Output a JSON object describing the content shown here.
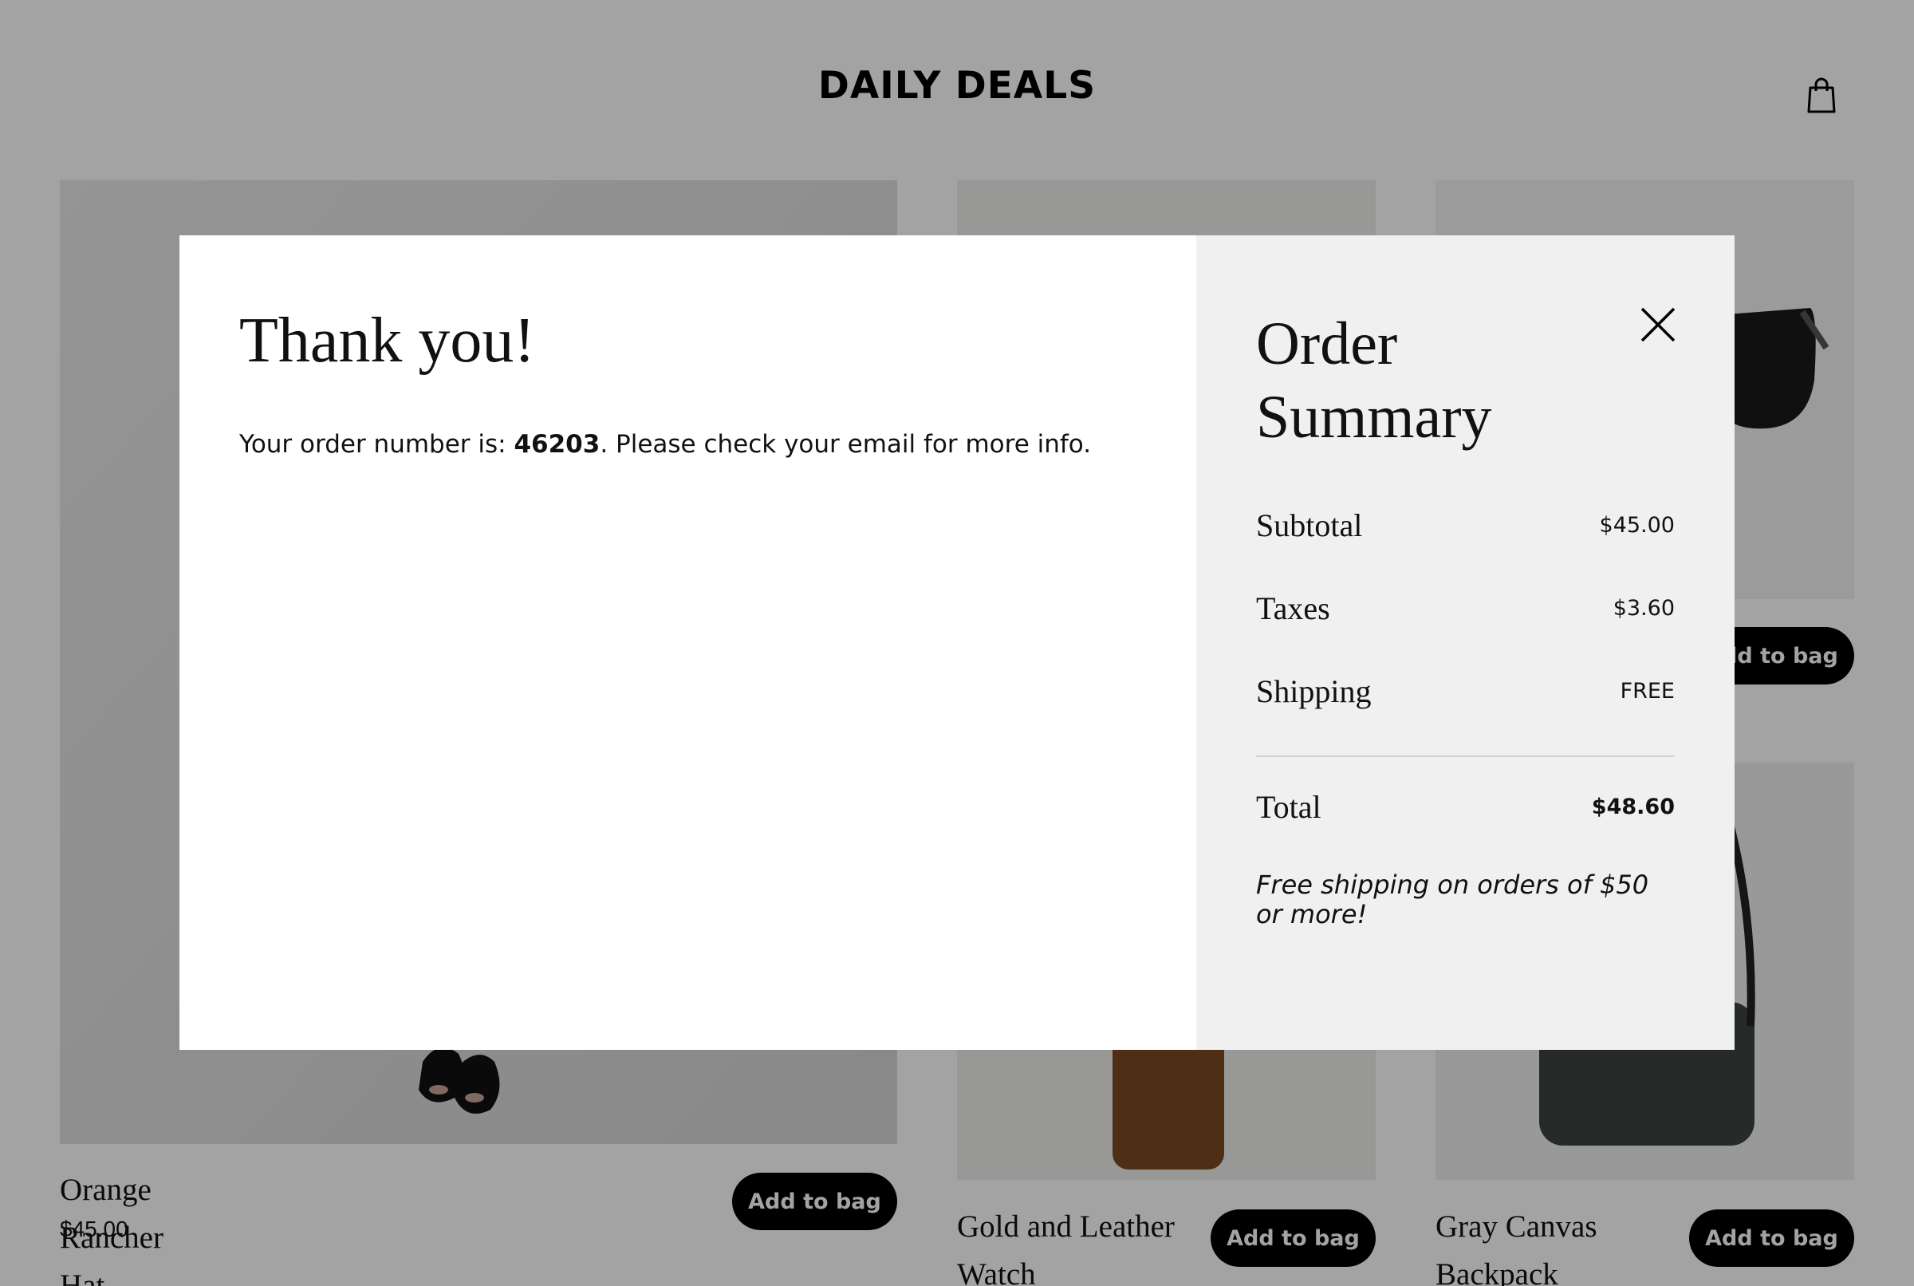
{
  "site": {
    "title": "DAILY DEALS"
  },
  "products": [
    {
      "name": "Orange Rancher Hat",
      "price": "$45.00",
      "button": "Add to bag"
    },
    {
      "name": "Gold and Leather Watch",
      "button": "Add to bag"
    },
    {
      "name": "Gray Canvas Backpack",
      "button": "Add to bag"
    },
    {
      "button": "Add to bag"
    }
  ],
  "confirmation": {
    "heading": "Thank you!",
    "message_prefix": "Your order number is: ",
    "order_number": "46203",
    "message_suffix": ". Please check your email for more info."
  },
  "summary": {
    "heading": "Order Summary",
    "rows": [
      {
        "label": "Subtotal",
        "value": "$45.00"
      },
      {
        "label": "Taxes",
        "value": "$3.60"
      },
      {
        "label": "Shipping",
        "value": "FREE"
      }
    ],
    "total_label": "Total",
    "total_value": "$48.60",
    "note": "Free shipping on orders of $50 or more!"
  },
  "icons": {
    "bag": "shopping-bag-icon",
    "close": "close-icon"
  },
  "colors": {
    "button_bg": "#000000",
    "summary_bg": "#f0f0f0",
    "scrim": "rgba(0,0,0,0.36)"
  }
}
